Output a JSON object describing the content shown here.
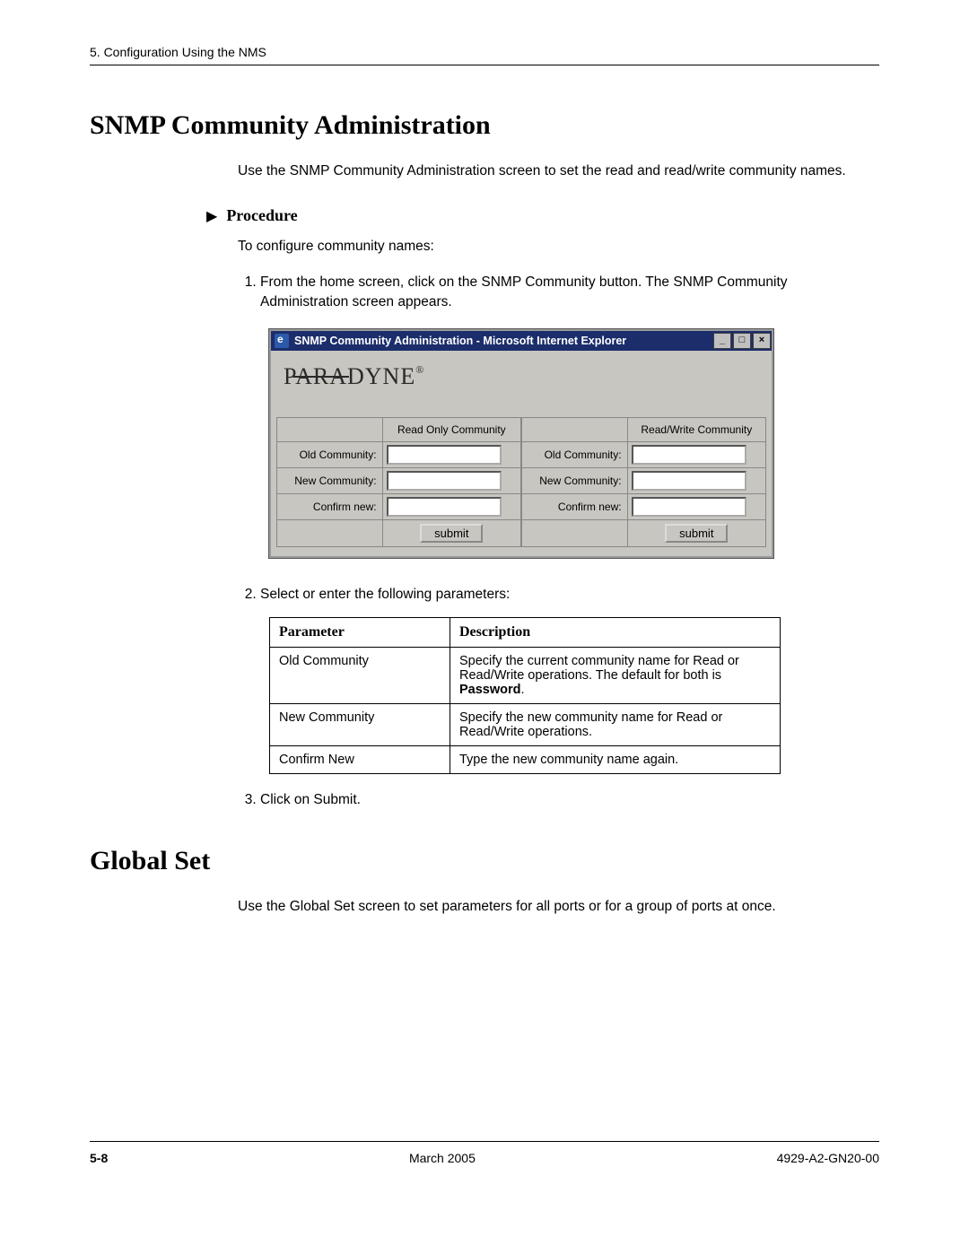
{
  "header": {
    "running": "5. Configuration Using the NMS"
  },
  "section1": {
    "title": "SNMP Community Administration",
    "intro": "Use the SNMP Community Administration screen to set the read and read/write community names.",
    "procedure_label": "Procedure",
    "lead": "To configure community names:",
    "step1": "From the home screen, click on the SNMP Community button. The SNMP Community Administration screen appears.",
    "step2": "Select or enter the following parameters:",
    "step3": "Click on Submit."
  },
  "screenshot": {
    "titlebar": "SNMP Community Administration - Microsoft Internet Explorer",
    "logo": "PARADYNE",
    "left_header": "Read Only Community",
    "right_header": "Read/Write Community",
    "row1_label": "Old Community:",
    "row2_label": "New Community:",
    "row3_label": "Confirm new:",
    "submit_label": "submit",
    "minimize": "_",
    "maximize": "□",
    "close": "×"
  },
  "param_table": {
    "col1": "Parameter",
    "col2": "Description",
    "rows": [
      {
        "p": "Old Community",
        "d1": "Specify the current community name for Read or Read/Write operations. The default for both is ",
        "d2": "Password",
        "d3": "."
      },
      {
        "p": "New Community",
        "d1": "Specify the new community name for Read or Read/Write operations.",
        "d2": "",
        "d3": ""
      },
      {
        "p": "Confirm New",
        "d1": "Type the new community name again.",
        "d2": "",
        "d3": ""
      }
    ]
  },
  "section2": {
    "title": "Global Set",
    "intro": "Use the Global Set screen to set parameters for all ports or for a group of ports at once."
  },
  "footer": {
    "page": "5-8",
    "date": "March 2005",
    "doc": "4929-A2-GN20-00"
  }
}
